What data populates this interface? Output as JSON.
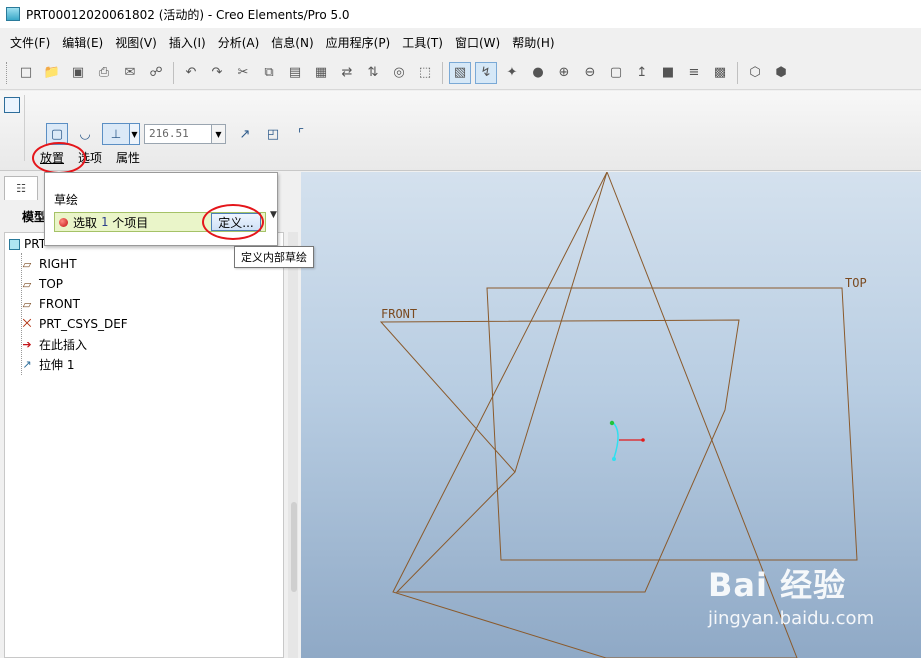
{
  "window": {
    "title": "PRT00012020061802 (活动的) - Creo Elements/Pro 5.0"
  },
  "menubar": {
    "items": [
      "文件(F)",
      "编辑(E)",
      "视图(V)",
      "插入(I)",
      "分析(A)",
      "信息(N)",
      "应用程序(P)",
      "工具(T)",
      "窗口(W)",
      "帮助(H)"
    ]
  },
  "dashboard": {
    "depth_value": "216.51",
    "tabs": [
      "放置",
      "选项",
      "属性"
    ],
    "active_tab": "放置"
  },
  "placement_panel": {
    "section_label": "草绘",
    "collector_prefix": "选取",
    "collector_count": "1",
    "collector_suffix": "个项目",
    "define_button": "定义...",
    "tooltip": "定义内部草绘"
  },
  "navigator": {
    "header": "模型",
    "root": "PRT",
    "items": [
      "RIGHT",
      "TOP",
      "FRONT",
      "PRT_CSYS_DEF",
      "在此插入",
      "拉伸 1"
    ]
  },
  "graphics": {
    "datum_labels": {
      "top": "TOP",
      "front": "FRONT"
    }
  },
  "watermark": {
    "brand": "Bai 经验",
    "url": "jingyan.baidu.com"
  },
  "colors": {
    "datum_line": "#8a5a2c",
    "highlight_circle": "#e4161b",
    "collector_bg": "#eaf5c9"
  }
}
